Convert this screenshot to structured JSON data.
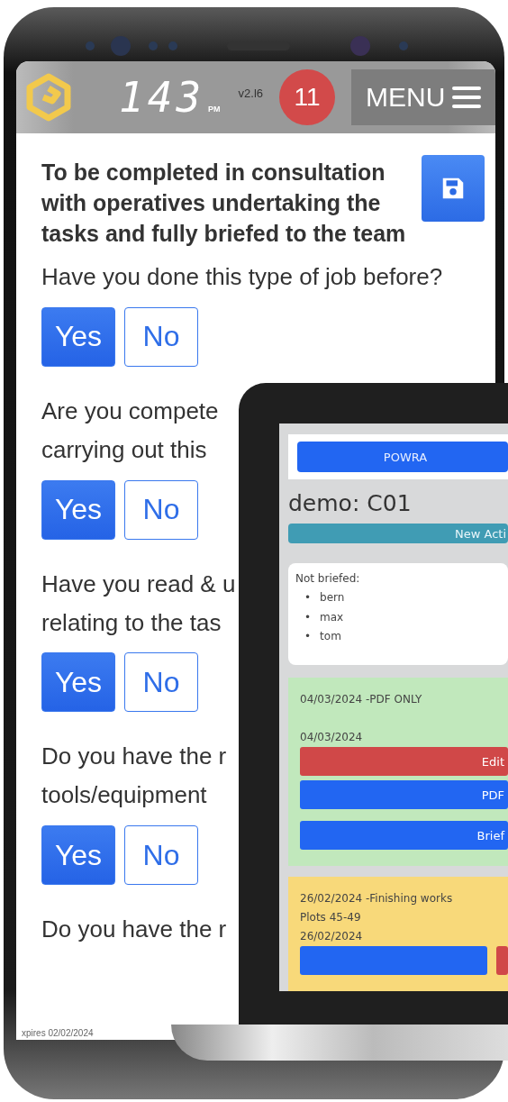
{
  "header": {
    "clock": "143",
    "meridiem": "PM",
    "version": "v2.l6",
    "notification_count": "11",
    "menu_label": "MENU"
  },
  "form": {
    "title": "To be completed in consultation with operatives undertaking the tasks and fully briefed to the team",
    "questions": [
      {
        "lines": [
          "Have you done this type of job before?"
        ],
        "answers": [
          {
            "label": "Yes",
            "selected": true
          },
          {
            "label": "No",
            "selected": false
          }
        ]
      },
      {
        "lines": [
          "Are you compete",
          "carrying out this"
        ],
        "answers": [
          {
            "label": "Yes",
            "selected": true
          },
          {
            "label": "No",
            "selected": false
          }
        ]
      },
      {
        "lines": [
          "Have you read & u",
          "relating to the tas"
        ],
        "answers": [
          {
            "label": "Yes",
            "selected": true
          },
          {
            "label": "No",
            "selected": false
          }
        ]
      },
      {
        "lines": [
          "Do you have the r",
          "tools/equipment"
        ],
        "answers": [
          {
            "label": "Yes",
            "selected": true
          },
          {
            "label": "No",
            "selected": false
          }
        ]
      },
      {
        "lines": [
          "Do you have the r"
        ]
      }
    ],
    "footer": "xpires 02/02/2024"
  },
  "laptop": {
    "nav_button": "POWRA",
    "heading": "demo: C01",
    "new_button": "New Acti",
    "not_briefed": {
      "label": "Not briefed:",
      "bullet": "•",
      "names": [
        "bern",
        "max",
        "tom"
      ]
    },
    "entries": [
      {
        "color": "#c1e8bc",
        "title": "04/03/2024 -PDF ONLY",
        "date": "04/03/2024",
        "buttons": [
          {
            "label": "Edit",
            "kind": "danger"
          },
          {
            "label": "PDF",
            "kind": "primary"
          },
          {
            "label": "Brief",
            "kind": "primary"
          }
        ]
      },
      {
        "color": "#f8d97a",
        "title": "26/02/2024 -Finishing works",
        "lines": [
          "Plots 45-49"
        ],
        "date": "26/02/2024",
        "buttons": [
          {
            "kind": "primary"
          },
          {
            "kind": "danger"
          }
        ]
      }
    ]
  }
}
